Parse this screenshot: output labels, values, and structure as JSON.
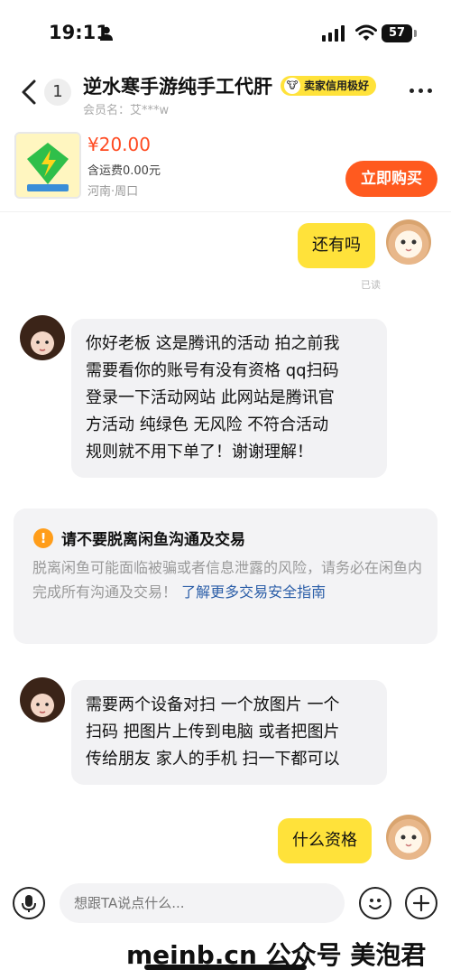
{
  "status": {
    "time": "19:11",
    "battery": "57"
  },
  "header": {
    "unread_count": "1",
    "title": "逆水寒手游纯手工代肝",
    "badge": "卖家信用极好",
    "member": "会员名：艾***w"
  },
  "product": {
    "price": "¥20.00",
    "shipping": "含运费0.00元",
    "location": "河南·周口",
    "buy_label": "立即购买"
  },
  "messages": [
    {
      "from": "me",
      "text": "还有吗",
      "status": "已读"
    },
    {
      "from": "them",
      "lines": [
        "你好老板 这是腾讯的活动 拍之前我",
        "需要看你的账号有没有资格 qq扫码",
        "登录一下活动网站 此网站是腾讯官",
        "方活动 纯绿色 无风险 不符合活动",
        "规则就不用下单了！谢谢理解！"
      ]
    },
    {
      "from": "them",
      "lines": [
        "需要两个设备对扫 一个放图片 一个",
        "扫码 把图片上传到电脑 或者把图片",
        "传给朋友 家人的手机 扫一下都可以"
      ]
    },
    {
      "from": "me",
      "text": "什么资格"
    }
  ],
  "warning": {
    "icon": "!",
    "title": "请不要脱离闲鱼沟通及交易",
    "body": "脱离闲鱼可能面临被骗或者信息泄露的风险，请务必在闲鱼内完成所有沟通及交易！",
    "link": "了解更多交易安全指南"
  },
  "input": {
    "placeholder": "想跟TA说点什么..."
  },
  "watermark": "meinb.cn  公众号 美泡君",
  "colors": {
    "accent": "#ffe23a",
    "buy": "#ff5a1f",
    "price": "#ff4a21",
    "link": "#2b5ea8"
  }
}
